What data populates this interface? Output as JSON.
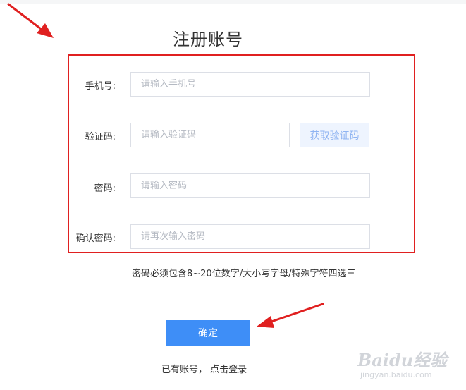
{
  "page": {
    "title": "注册账号"
  },
  "form": {
    "phone": {
      "label": "手机号:",
      "placeholder": "请输入手机号",
      "value": ""
    },
    "code": {
      "label": "验证码:",
      "placeholder": "请输入验证码",
      "value": "",
      "button_label": "获取验证码"
    },
    "password": {
      "label": "密码:",
      "placeholder": "请输入密码",
      "value": ""
    },
    "confirm_password": {
      "label": "确认密码:",
      "placeholder": "请再次输入密码",
      "value": ""
    }
  },
  "hint": "密码必须包含8~20位数字/大小写字母/特殊字符四选三",
  "confirm_button": "确定",
  "login": {
    "prefix": "已有账号，",
    "link": "点击登录"
  },
  "watermark": {
    "main": "Baidu经验",
    "sub": "jingyan.baidu.com"
  },
  "colors": {
    "primary": "#3e8ef7",
    "highlight_border": "#e02020",
    "arrow": "#e02020",
    "code_button_bg": "#eef4fe",
    "code_button_text": "#8fb4f2"
  }
}
